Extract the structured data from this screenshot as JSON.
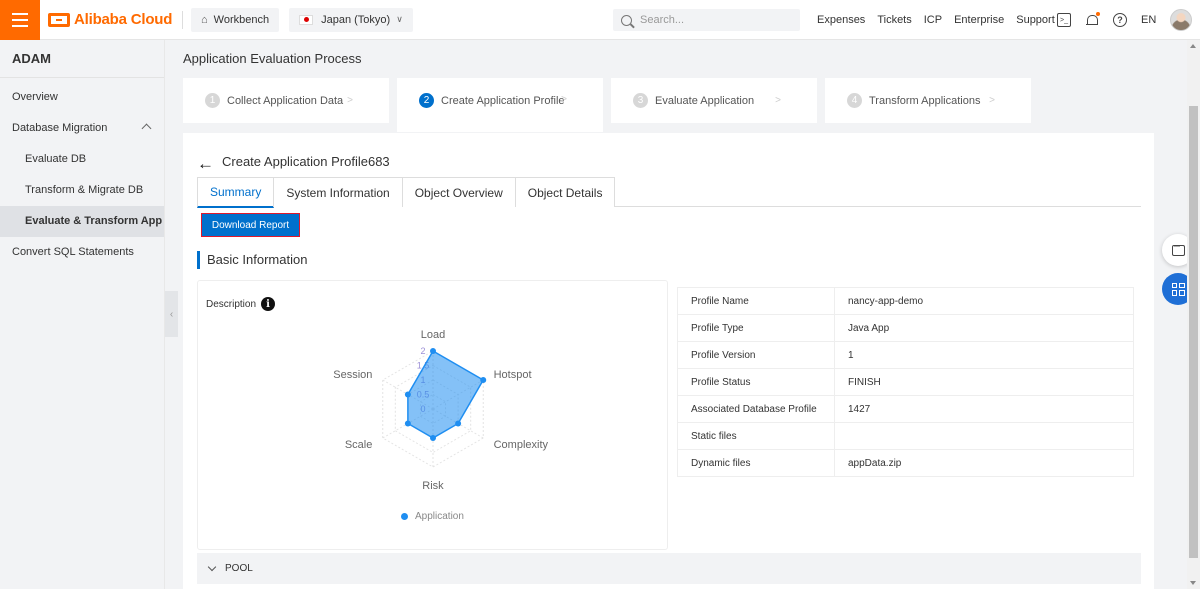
{
  "topbar": {
    "brand": "Alibaba Cloud",
    "workbench": "Workbench",
    "region": "Japan (Tokyo)",
    "search_placeholder": "Search...",
    "links": [
      "Expenses",
      "Tickets",
      "ICP",
      "Enterprise",
      "Support"
    ],
    "lang": "EN"
  },
  "sidebar": {
    "title": "ADAM",
    "items": [
      {
        "label": "Overview"
      },
      {
        "label": "Database Migration"
      },
      {
        "label": "Evaluate DB"
      },
      {
        "label": "Transform & Migrate DB"
      },
      {
        "label": "Evaluate & Transform App"
      },
      {
        "label": "Convert SQL Statements"
      }
    ]
  },
  "main": {
    "page_title": "Application Evaluation Process",
    "steps": [
      {
        "num": "1",
        "label": "Collect Application Data"
      },
      {
        "num": "2",
        "label": "Create Application Profile"
      },
      {
        "num": "3",
        "label": "Evaluate Application"
      },
      {
        "num": "4",
        "label": "Transform Applications"
      }
    ],
    "back_title": "Create Application Profile683",
    "tabs": [
      "Summary",
      "System Information",
      "Object Overview",
      "Object Details"
    ],
    "download_button": "Download Report",
    "section_title": "Basic Information",
    "description_label": "Description",
    "pool_label": "POOL"
  },
  "profile_info": [
    {
      "key": "Profile Name",
      "value": "nancy-app-demo"
    },
    {
      "key": "Profile Type",
      "value": "Java App"
    },
    {
      "key": "Profile Version",
      "value": "1"
    },
    {
      "key": "Profile Status",
      "value": "FINISH"
    },
    {
      "key": "Associated Database Profile",
      "value": "1427"
    },
    {
      "key": "Static files",
      "value": ""
    },
    {
      "key": "Dynamic files",
      "value": "appData.zip"
    }
  ],
  "chart_data": {
    "type": "radar",
    "axes": [
      "Load",
      "Hotspot",
      "Complexity",
      "Risk",
      "Scale",
      "Session"
    ],
    "radial_ticks": [
      "0",
      "0.5",
      "1",
      "1.5",
      "2"
    ],
    "rmax": 2,
    "series": [
      {
        "name": "Application",
        "values": [
          2,
          2,
          1,
          1,
          1,
          1
        ]
      }
    ],
    "color": "#1f8ef1"
  }
}
